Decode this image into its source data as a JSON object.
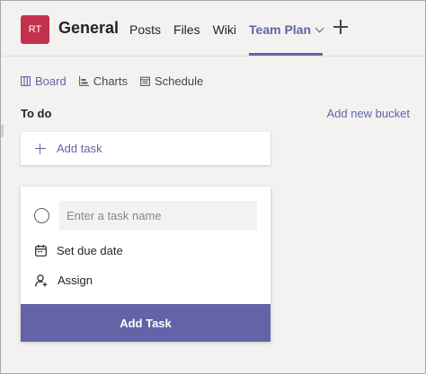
{
  "header": {
    "avatar_initials": "RT",
    "channel_name": "General",
    "tabs": [
      {
        "label": "Posts"
      },
      {
        "label": "Files"
      },
      {
        "label": "Wiki"
      },
      {
        "label": "Team Plan",
        "active": true
      }
    ],
    "add_tab_icon": "plus-icon"
  },
  "subnav": {
    "items": [
      {
        "label": "Board",
        "icon": "board-icon",
        "active": true
      },
      {
        "label": "Charts",
        "icon": "charts-icon"
      },
      {
        "label": "Schedule",
        "icon": "schedule-icon"
      }
    ]
  },
  "board": {
    "bucket_title": "To do",
    "add_bucket_label": "Add new bucket",
    "add_task_label": "Add task"
  },
  "task_form": {
    "name_placeholder": "Enter a task name",
    "due_date_label": "Set due date",
    "assign_label": "Assign",
    "submit_label": "Add Task"
  },
  "colors": {
    "accent": "#6264a7",
    "avatar_bg": "#c4314b"
  }
}
